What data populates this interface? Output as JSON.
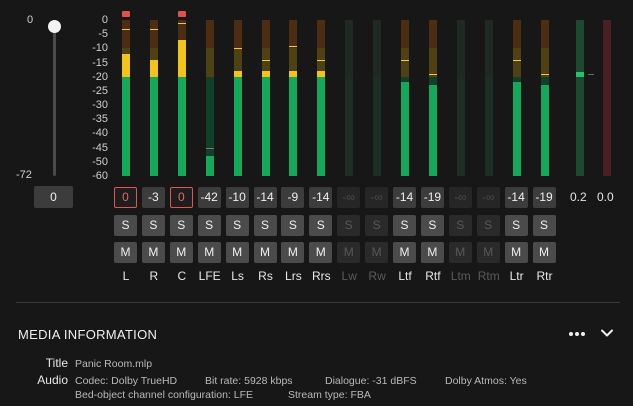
{
  "fader": {
    "top_label": "0",
    "bottom_label": "-72",
    "value": "0",
    "level_fraction": 1.0
  },
  "scale": {
    "ticks": [
      "0",
      "-5",
      "-10",
      "-15",
      "-20",
      "-25",
      "-30",
      "-35",
      "-40",
      "-45",
      "-50",
      "-60"
    ]
  },
  "colors": {
    "green": "#14a85a",
    "green_dim": "#123f28",
    "yellow": "#f2c318",
    "yellow_dim": "#4e4212",
    "orange_dim": "#4d2d12",
    "clip": "#e0504d",
    "peak_line": "#f4c840",
    "peak_line_dim": "#7a7a7a"
  },
  "channels": [
    {
      "name": "L",
      "peak": "0",
      "over": true,
      "active": true,
      "clip": true,
      "level_db": -12,
      "peak_db": -3
    },
    {
      "name": "R",
      "peak": "-3",
      "over": false,
      "active": true,
      "clip": false,
      "level_db": -14,
      "peak_db": -3
    },
    {
      "name": "C",
      "peak": "0",
      "over": true,
      "active": true,
      "clip": true,
      "level_db": -7,
      "peak_db": -1
    },
    {
      "name": "LFE",
      "peak": "-42",
      "over": false,
      "active": true,
      "clip": false,
      "level_db": -48,
      "peak_db": -45,
      "weak": true
    },
    {
      "name": "Ls",
      "peak": "-10",
      "over": false,
      "active": true,
      "clip": false,
      "level_db": -18,
      "peak_db": -10
    },
    {
      "name": "Rs",
      "peak": "-14",
      "over": false,
      "active": true,
      "clip": false,
      "level_db": -18,
      "peak_db": -14
    },
    {
      "name": "Lrs",
      "peak": "-9",
      "over": false,
      "active": true,
      "clip": false,
      "level_db": -18,
      "peak_db": -9
    },
    {
      "name": "Rrs",
      "peak": "-14",
      "over": false,
      "active": true,
      "clip": false,
      "level_db": -18,
      "peak_db": -14
    },
    {
      "name": "Lw",
      "peak": "-∞",
      "over": false,
      "active": false,
      "clip": false
    },
    {
      "name": "Rw",
      "peak": "-∞",
      "over": false,
      "active": false,
      "clip": false
    },
    {
      "name": "Ltf",
      "peak": "-14",
      "over": false,
      "active": true,
      "clip": false,
      "level_db": -22,
      "peak_db": -14
    },
    {
      "name": "Rtf",
      "peak": "-19",
      "over": false,
      "active": true,
      "clip": false,
      "level_db": -23,
      "peak_db": -19
    },
    {
      "name": "Ltm",
      "peak": "-∞",
      "over": false,
      "active": false,
      "clip": false
    },
    {
      "name": "Rtm",
      "peak": "-∞",
      "over": false,
      "active": false,
      "clip": false
    },
    {
      "name": "Ltr",
      "peak": "-14",
      "over": false,
      "active": true,
      "clip": false,
      "level_db": -22,
      "peak_db": -14
    },
    {
      "name": "Rtr",
      "peak": "-19",
      "over": false,
      "active": true,
      "clip": false,
      "level_db": -23,
      "peak_db": -19
    }
  ],
  "solo_label": "S",
  "mute_label": "M",
  "extra_meters": [
    {
      "value": "0.2",
      "level_db": -19,
      "color": "green"
    },
    {
      "value": "0.0",
      "level_db": -60,
      "color": "red"
    }
  ],
  "media_info": {
    "heading": "MEDIA INFORMATION",
    "title_key": "Title",
    "title_value": "Panic Room.mlp",
    "audio_key": "Audio",
    "audio_line1": [
      "Codec: Dolby TrueHD",
      "Bit rate: 5928 kbps",
      "Dialogue: -31 dBFS",
      "Dolby Atmos: Yes"
    ],
    "audio_line2": [
      "Bed-object channel configuration: LFE",
      "Stream type: FBA"
    ]
  }
}
